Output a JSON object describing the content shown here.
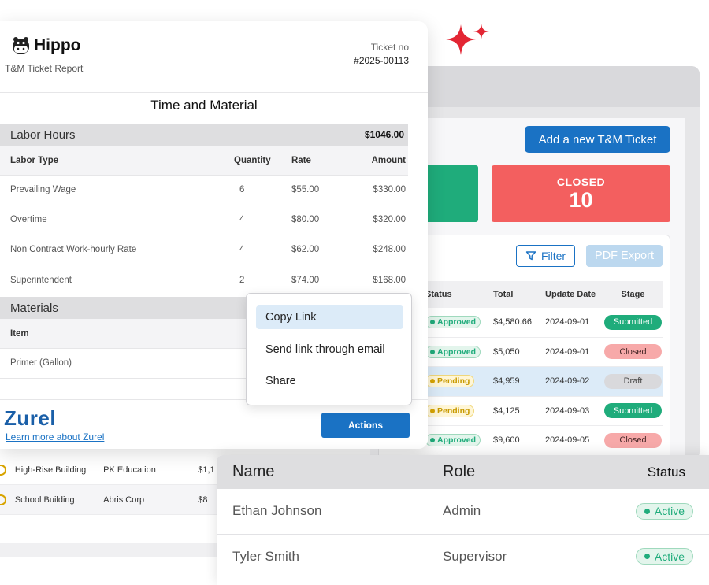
{
  "colors": {
    "accent": "#1a72c4",
    "green": "#1fac7b",
    "red": "#f35f5f",
    "sparkle": "#e32634"
  },
  "dashboard": {
    "add_ticket_label": "Add a new T&M Ticket",
    "closed_label": "CLOSED",
    "closed_count": "10",
    "filter_label": "Filter",
    "pdf_export_label": "PDF Export",
    "table": {
      "headers": [
        "Status",
        "Total",
        "Update Date",
        "Stage"
      ],
      "rows": [
        {
          "status": "Approved",
          "total": "$4,580.66",
          "date": "2024-09-01",
          "stage": "Submitted"
        },
        {
          "status": "Approved",
          "total": "$5,050",
          "date": "2024-09-01",
          "stage": "Closed"
        },
        {
          "status": "Pending",
          "total": "$4,959",
          "date": "2024-09-02",
          "stage": "Draft"
        },
        {
          "status": "Pending",
          "total": "$4,125",
          "date": "2024-09-03",
          "stage": "Submitted"
        },
        {
          "status": "Approved",
          "total": "$9,600",
          "date": "2024-09-05",
          "stage": "Closed"
        }
      ]
    }
  },
  "projects": [
    {
      "name": "High-Rise Building",
      "client": "PK Education",
      "amount": "$1,1"
    },
    {
      "name": "School Building",
      "client": "Abris Corp",
      "amount": "$8"
    }
  ],
  "report": {
    "brand": "Hippo",
    "subtitle": "T&M Ticket Report",
    "ticket_label": "Ticket no",
    "ticket_number": "#2025-00113",
    "title": "Time and Material",
    "labor": {
      "section_title": "Labor Hours",
      "section_total": "$1046.00",
      "headers": {
        "type": "Labor Type",
        "qty": "Quantity",
        "rate": "Rate",
        "amount": "Amount"
      },
      "rows": [
        {
          "type": "Prevailing Wage",
          "qty": "6",
          "rate": "$55.00",
          "amount": "$330.00"
        },
        {
          "type": "Overtime",
          "qty": "4",
          "rate": "$80.00",
          "amount": "$320.00"
        },
        {
          "type": "Non Contract Work-hourly Rate",
          "qty": "4",
          "rate": "$62.00",
          "amount": "$248.00"
        },
        {
          "type": "Superintendent",
          "qty": "2",
          "rate": "$74.00",
          "amount": "$168.00"
        }
      ]
    },
    "materials": {
      "section_title": "Materials",
      "header_item": "Item",
      "rows": [
        {
          "item": "Primer (Gallon)"
        }
      ]
    },
    "footer": {
      "logo_text": "Zurel",
      "learn_more": "Learn more about Zurel",
      "actions_label": "Actions"
    }
  },
  "menu": {
    "items": [
      "Copy Link",
      "Send link through email",
      "Share"
    ]
  },
  "users": {
    "headers": {
      "name": "Name",
      "role": "Role",
      "status": "Status"
    },
    "rows": [
      {
        "name": "Ethan Johnson",
        "role": "Admin",
        "status": "Active"
      },
      {
        "name": "Tyler Smith",
        "role": "Supervisor",
        "status": "Active"
      }
    ]
  }
}
